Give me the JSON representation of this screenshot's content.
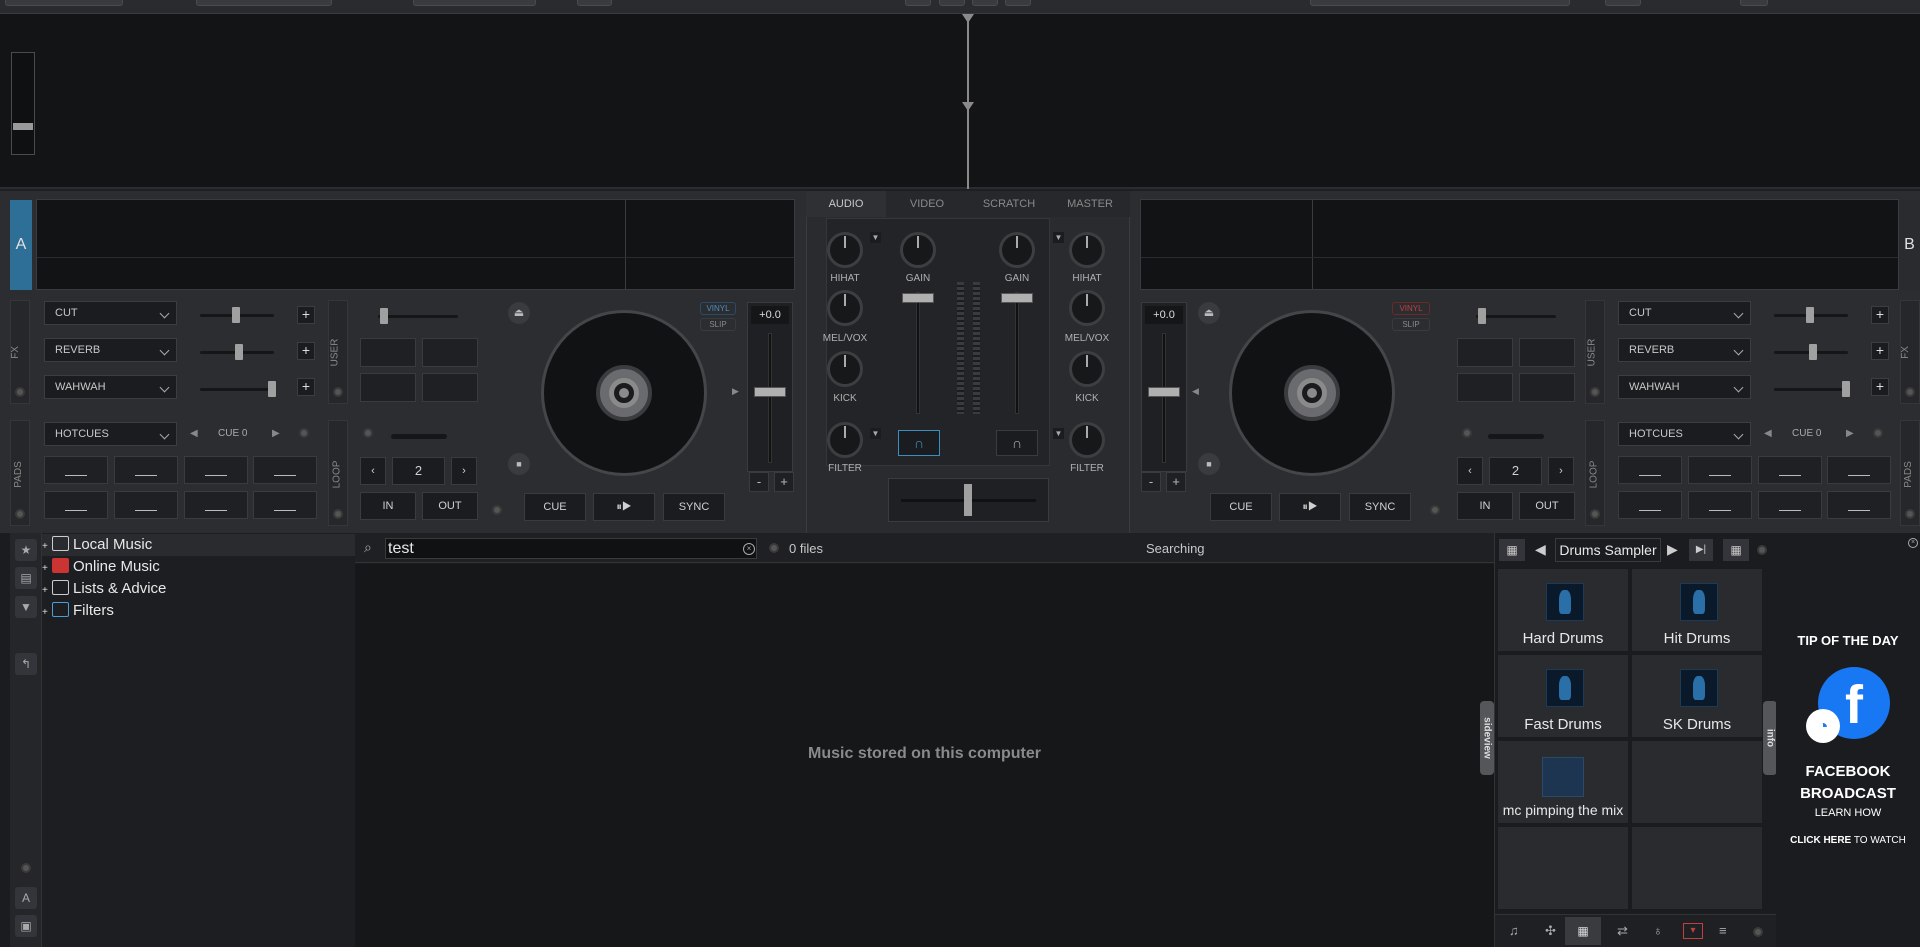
{
  "deck_a": {
    "label": "A",
    "fx": [
      "CUT",
      "REVERB",
      "WAHWAH"
    ],
    "fx_side_label": "FX",
    "user_side_label": "USER",
    "pads_mode": "HOTCUES",
    "pads_page": "CUE 0",
    "pads_side_label": "PADS",
    "loop_side_label": "LOOP",
    "loop_size": "2",
    "loop_in": "IN",
    "loop_out": "OUT",
    "vinyl": "VINYL",
    "slip": "SLIP",
    "pitch": "+0.0",
    "cue": "CUE",
    "play": "⏸▶",
    "sync": "SYNC",
    "minus": "-",
    "plus": "+"
  },
  "deck_b": {
    "label": "B",
    "fx": [
      "CUT",
      "REVERB",
      "WAHWAH"
    ],
    "fx_side_label": "FX",
    "user_side_label": "USER",
    "pads_mode": "HOTCUES",
    "pads_page": "CUE 0",
    "pads_side_label": "PADS",
    "loop_side_label": "LOOP",
    "loop_size": "2",
    "loop_in": "IN",
    "loop_out": "OUT",
    "vinyl": "VINYL",
    "slip": "SLIP",
    "pitch": "+0.0",
    "cue": "CUE",
    "play": "⏸▶",
    "sync": "SYNC",
    "minus": "-",
    "plus": "+"
  },
  "mixer": {
    "tabs": [
      "AUDIO",
      "VIDEO",
      "SCRATCH",
      "MASTER"
    ],
    "active_tab": "AUDIO",
    "left_knobs": [
      "HIHAT",
      "MEL/VOX",
      "KICK",
      "FILTER"
    ],
    "right_knobs": [
      "HIHAT",
      "MEL/VOX",
      "KICK",
      "FILTER"
    ],
    "gain_left": "GAIN",
    "gain_right": "GAIN"
  },
  "browser": {
    "tree": [
      "Local Music",
      "Online Music",
      "Lists & Advice",
      "Filters"
    ],
    "search_value": "test",
    "file_count": "0 files",
    "status": "Searching",
    "empty_message": "Music stored on this computer",
    "folders_tab": "folders",
    "sideview_tab": "sideview",
    "info_tab": "info"
  },
  "sampler": {
    "bank": "Drums Sampler",
    "cells": [
      "Hard Drums",
      "Hit Drums",
      "Fast Drums",
      "SK Drums",
      "mc pimping the mix",
      "",
      "",
      ""
    ]
  },
  "tip": {
    "title": "TIP OF THE DAY",
    "line1": "FACEBOOK",
    "line2": "BROADCAST",
    "line3": "LEARN HOW",
    "click_here": "CLICK HERE",
    "to_watch": "TO WATCH"
  },
  "colors": {
    "deck_accent": "#2d6f96",
    "vinyl_a": "#4a8fc0",
    "vinyl_b": "#c04040",
    "facebook": "#1877f2"
  }
}
